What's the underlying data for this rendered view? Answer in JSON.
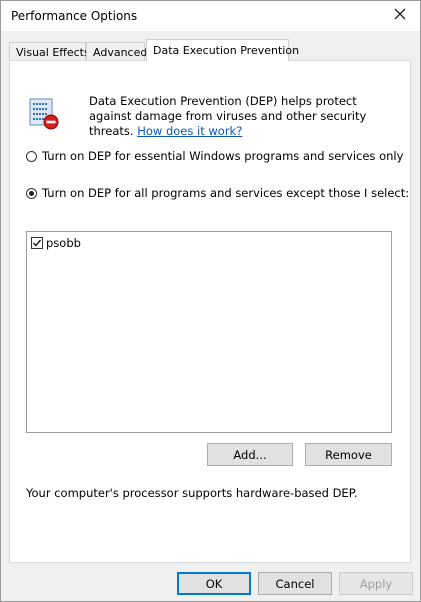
{
  "window": {
    "title": "Performance Options"
  },
  "tabs": [
    {
      "label": "Visual Effects"
    },
    {
      "label": "Advanced"
    },
    {
      "label": "Data Execution Prevention"
    }
  ],
  "dep": {
    "description": "Data Execution Prevention (DEP) helps protect against damage from viruses and other security threats.",
    "link": "How does it work?",
    "radio_essential": "Turn on DEP for essential Windows programs and services only",
    "radio_all": "Turn on DEP for all programs and services except those I select:",
    "exceptions": [
      {
        "label": "psobb",
        "checked": true
      }
    ],
    "add_label": "Add...",
    "remove_label": "Remove",
    "support_note": "Your computer's processor supports hardware-based DEP."
  },
  "footer": {
    "ok": "OK",
    "cancel": "Cancel",
    "apply": "Apply"
  },
  "colors": {
    "link": "#0a56c2",
    "focus": "#0078d7"
  }
}
